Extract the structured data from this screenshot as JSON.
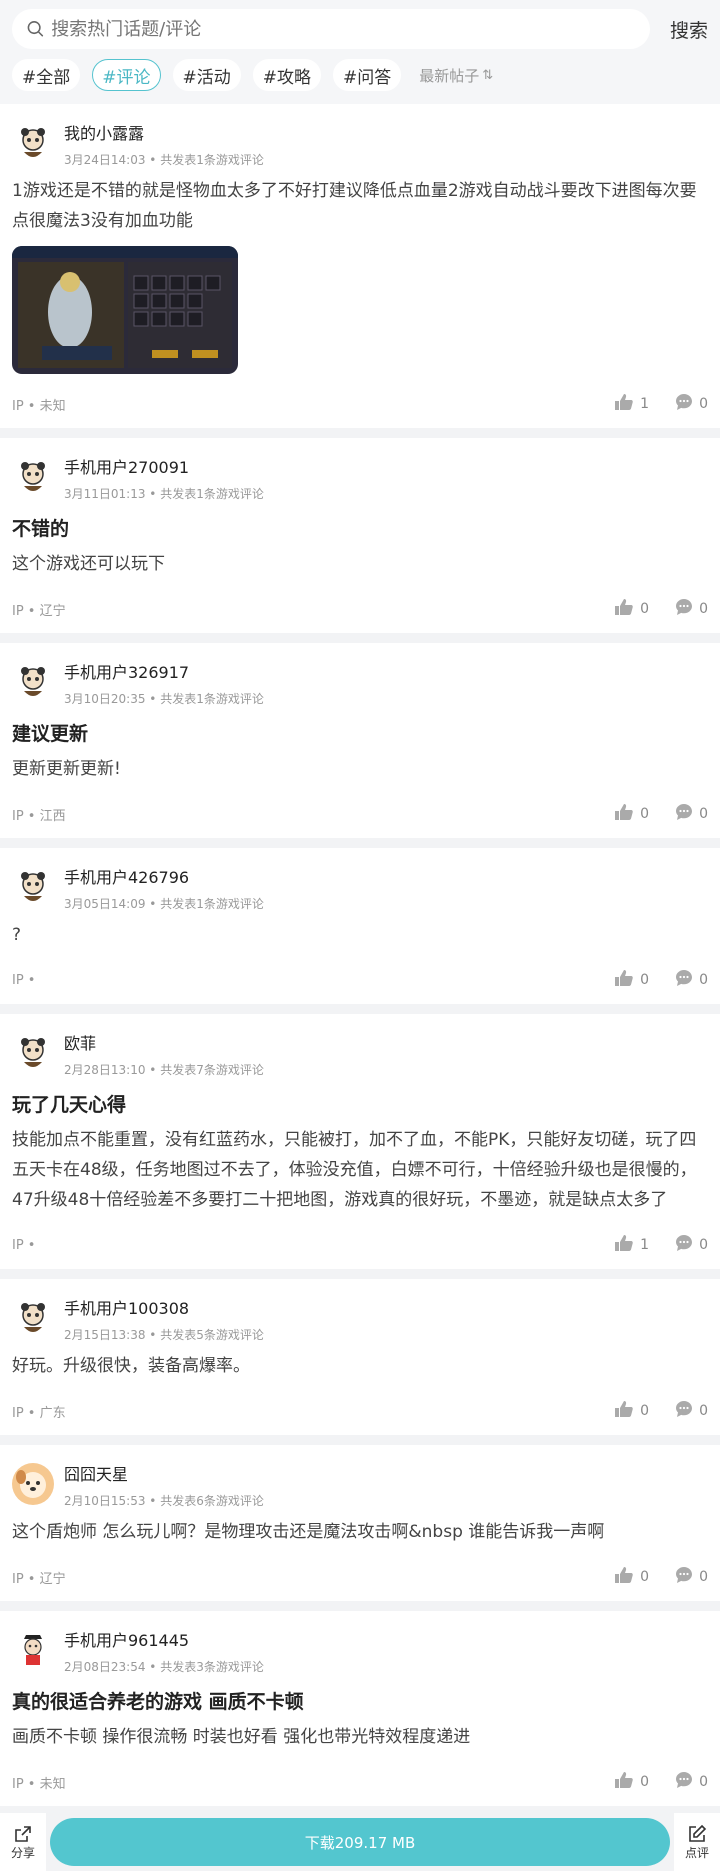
{
  "search": {
    "placeholder": "搜索热门话题/评论",
    "button": "搜索"
  },
  "tags": [
    "#全部",
    "#评论",
    "#活动",
    "#攻略",
    "#问答"
  ],
  "active_tag": 1,
  "sort_label": "最新帖子",
  "sort_icon": "⇅",
  "posts": [
    {
      "user": "我的小露露",
      "meta": "3月24日14:03 • 共发表1条游戏评论",
      "title": "",
      "body": "1游戏还是不错的就是怪物血太多了不好打建议降低点血量2游戏自动战斗要改下进图每次要点很魔法3没有加血功能",
      "has_image": true,
      "ip": "IP • 未知",
      "likes": "1",
      "comments": "0",
      "avatar": "panda"
    },
    {
      "user": "手机用户270091",
      "meta": "3月11日01:13 • 共发表1条游戏评论",
      "title": "不错的",
      "body": "这个游戏还可以玩下",
      "has_image": false,
      "ip": "IP • 辽宁",
      "likes": "0",
      "comments": "0",
      "avatar": "panda"
    },
    {
      "user": "手机用户326917",
      "meta": "3月10日20:35 • 共发表1条游戏评论",
      "title": "建议更新",
      "body": "更新更新更新!",
      "has_image": false,
      "ip": "IP • 江西",
      "likes": "0",
      "comments": "0",
      "avatar": "panda"
    },
    {
      "user": "手机用户426796",
      "meta": "3月05日14:09 • 共发表1条游戏评论",
      "title": "",
      "body": "?",
      "has_image": false,
      "ip": "IP •",
      "likes": "0",
      "comments": "0",
      "avatar": "panda"
    },
    {
      "user": "欧菲",
      "meta": "2月28日13:10 • 共发表7条游戏评论",
      "title": "玩了几天心得",
      "body": "技能加点不能重置，没有红蓝药水，只能被打，加不了血，不能PK，只能好友切磋，玩了四五天卡在48级，任务地图过不去了，体验没充值，白嫖不可行，十倍经验升级也是很慢的，47升级48十倍经验差不多要打二十把地图，游戏真的很好玩，不墨迹，就是缺点太多了",
      "clamp": true,
      "has_image": false,
      "ip": "IP •",
      "likes": "1",
      "comments": "0",
      "avatar": "panda"
    },
    {
      "user": "手机用户100308",
      "meta": "2月15日13:38 • 共发表5条游戏评论",
      "title": "",
      "body": "好玩。升级很快，装备高爆率。",
      "has_image": false,
      "ip": "IP • 广东",
      "likes": "0",
      "comments": "0",
      "avatar": "panda"
    },
    {
      "user": "囧囧天星",
      "meta": "2月10日15:53 • 共发表6条游戏评论",
      "title": "",
      "body": "这个盾炮师 怎么玩儿啊？是物理攻击还是魔法攻击啊&nbsp 谁能告诉我一声啊",
      "has_image": false,
      "ip": "IP • 辽宁",
      "likes": "0",
      "comments": "0",
      "avatar": "dog"
    },
    {
      "user": "手机用户961445",
      "meta": "2月08日23:54 • 共发表3条游戏评论",
      "title": "真的很适合养老的游戏 画质不卡顿",
      "body": "画质不卡顿 操作很流畅 时装也好看 强化也带光特效程度递进",
      "has_image": false,
      "ip": "IP • 未知",
      "likes": "0",
      "comments": "0",
      "avatar": "kid"
    }
  ],
  "bottom": {
    "share": "分享",
    "download": "下载209.17 MB",
    "review": "点评"
  },
  "colors": {
    "accent": "#53c6cf",
    "tag_active": "#4bb8c5"
  }
}
